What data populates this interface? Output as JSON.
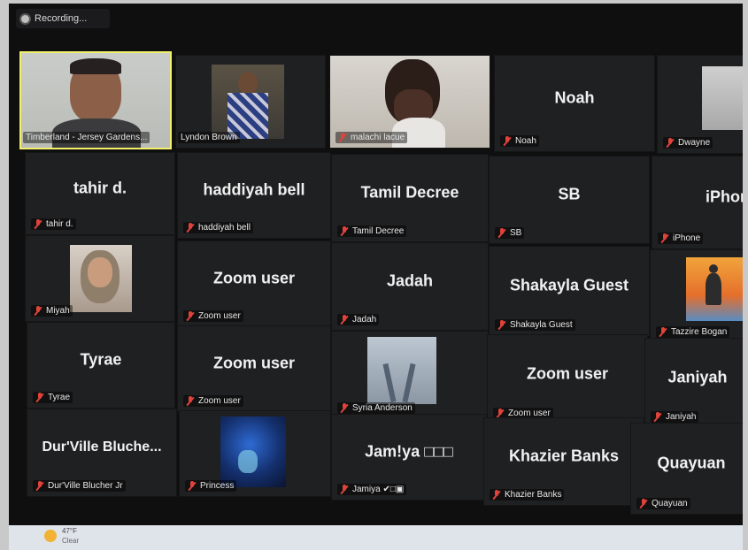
{
  "recording": {
    "label": "Recording..."
  },
  "participants": [
    {
      "big": "",
      "tag": "Timberland - Jersey Gardens..."
    },
    {
      "big": "",
      "tag": "Lyndon Brown"
    },
    {
      "big": "",
      "tag": "malachi lacue"
    },
    {
      "big": "Noah",
      "tag": "Noah"
    },
    {
      "big": "",
      "tag": "Dwayne"
    },
    {
      "big": "tahir d.",
      "tag": "tahir d."
    },
    {
      "big": "haddiyah bell",
      "tag": "haddiyah bell"
    },
    {
      "big": "Tamil Decree",
      "tag": "Tamil Decree"
    },
    {
      "big": "SB",
      "tag": "SB"
    },
    {
      "big": "iPhone",
      "tag": "iPhone"
    },
    {
      "big": "",
      "tag": "Miyah"
    },
    {
      "big": "Zoom user",
      "tag": "Zoom user"
    },
    {
      "big": "Jadah",
      "tag": "Jadah"
    },
    {
      "big": "Shakayla Guest",
      "tag": "Shakayla Guest"
    },
    {
      "big": "",
      "tag": "Tazzire Bogan"
    },
    {
      "big": "Tyrae",
      "tag": "Tyrae"
    },
    {
      "big": "Zoom user",
      "tag": "Zoom user"
    },
    {
      "big": "",
      "tag": "Syria Anderson"
    },
    {
      "big": "Zoom user",
      "tag": "Zoom user"
    },
    {
      "big": "Janiyah",
      "tag": "Janiyah"
    },
    {
      "big": "Dur'Ville Bluche...",
      "tag": "Dur'Ville Blucher Jr"
    },
    {
      "big": "",
      "tag": "Princess"
    },
    {
      "big": "Jam!ya □□□",
      "tag": "Jamiya ✔□▣"
    },
    {
      "big": "Khazier Banks",
      "tag": "Khazier Banks"
    },
    {
      "big": "Quayuan",
      "tag": "Quayuan"
    }
  ],
  "taskbar": {
    "temp": "47°F",
    "condition": "Clear"
  }
}
